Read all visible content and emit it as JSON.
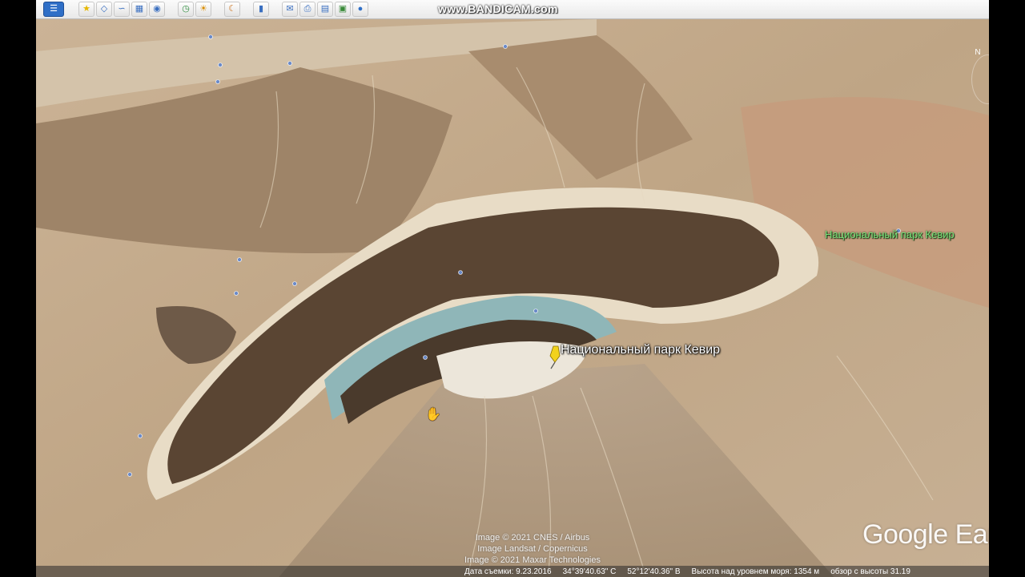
{
  "watermark": "www.BANDICAM.com",
  "toolbar": {
    "icons": [
      "sidebar-toggle-icon",
      "placemark-icon",
      "polygon-icon",
      "path-icon",
      "image-overlay-icon",
      "tour-icon",
      "historical-imagery-icon",
      "sunlight-icon",
      "planets-icon",
      "ruler-icon",
      "email-icon",
      "print-icon",
      "save-image-icon",
      "maps-icon",
      "globe-icon"
    ]
  },
  "map": {
    "place_label": "Национальный парк Кевир",
    "far_label": "Национальный парк Кевир",
    "credits": [
      "Image © 2021 CNES / Airbus",
      "Image Landsat / Copernicus",
      "Image © 2021 Maxar Technologies"
    ],
    "logo": "Google Ear",
    "north_label": "N"
  },
  "status": {
    "date": "Дата съемки: 9.23.2016",
    "lat": "34°39'40.63\" С",
    "lon": "52°12'40.36\" В",
    "elevation": "Высота над уровнем моря: 1354 м",
    "eye_alt": "обзор с высоты 31.19"
  },
  "colors": {
    "accent": "#2f6fc7",
    "far_label": "#7be37b",
    "pin": "#f2d21c"
  }
}
